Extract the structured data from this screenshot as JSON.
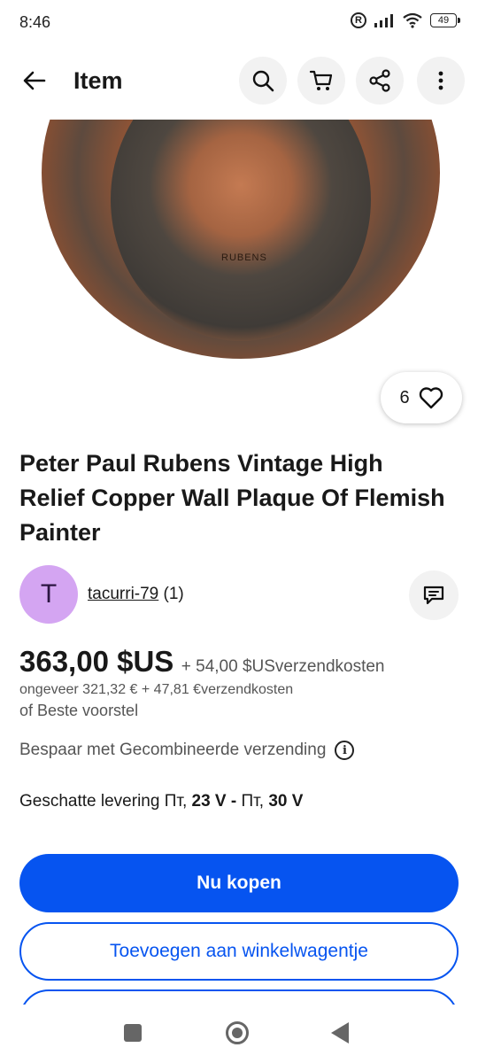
{
  "status_bar": {
    "time": "8:46",
    "battery": "49",
    "icons": [
      "registered-icon",
      "signal-icon",
      "wifi-icon",
      "battery-icon"
    ]
  },
  "app_bar": {
    "title": "Item",
    "icons": [
      "back-arrow-icon",
      "search-icon",
      "cart-icon",
      "share-icon",
      "more-vertical-icon"
    ]
  },
  "hero": {
    "plaque_text": "RUBENS",
    "like_count": "6"
  },
  "listing": {
    "title": "Peter Paul Rubens Vintage High Relief Copper Wall Plaque Of Flemish Painter"
  },
  "seller": {
    "avatar_letter": "T",
    "name": "tacurri-79",
    "feedback": "(1)"
  },
  "pricing": {
    "price": "363,00 $US",
    "shipping": "+ 54,00 $USverzendkosten",
    "approx": "ongeveer 321,32 € + 47,81 €verzendkosten",
    "best_offer": "of Beste voorstel"
  },
  "combined_shipping": "Bespaar met Gecombineerde verzending",
  "delivery": {
    "label": "Geschatte levering",
    "range_start_prefix": "Пт,",
    "range_start_bold": "23 V",
    "separator": "-",
    "range_end_prefix": "Пт,",
    "range_end_bold": "30 V"
  },
  "actions": {
    "buy_now": "Nu kopen",
    "add_to_cart": "Toevoegen aan winkelwagentje"
  },
  "colors": {
    "primary": "#0654f0",
    "avatar_bg": "#d4a5f2",
    "pill_bg": "#f2f2f2"
  }
}
